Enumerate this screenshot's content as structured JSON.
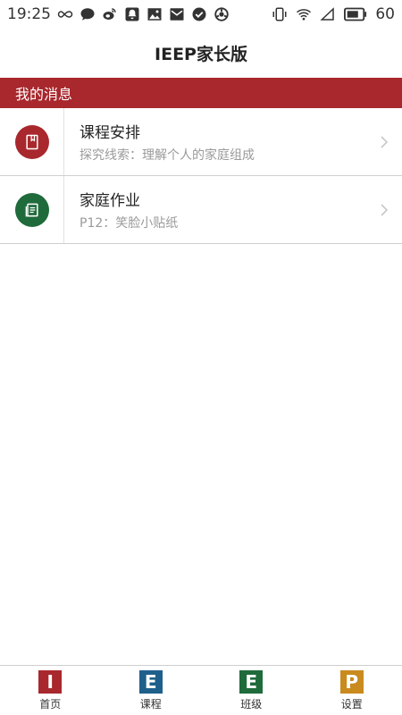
{
  "status_bar": {
    "time": "19:25",
    "battery": "60",
    "icons_left": [
      "infinity-icon",
      "chat-icon",
      "weibo-icon",
      "bell-icon",
      "image-icon",
      "mail-icon",
      "check-circle-icon",
      "sync-icon"
    ],
    "icons_right": [
      "vibrate-icon",
      "wifi-icon",
      "signal-icon",
      "battery-icon"
    ]
  },
  "header": {
    "title": "IEEP家长版"
  },
  "section": {
    "title": "我的消息",
    "color": "#a8282d"
  },
  "messages": [
    {
      "title": "课程安排",
      "subtitle": "探究线索：理解个人的家庭组成",
      "icon": "book-icon",
      "color": "#a8282d"
    },
    {
      "title": "家庭作业",
      "subtitle": "P12：笑脸小贴纸",
      "icon": "homework-icon",
      "color": "#1f6b3b"
    }
  ],
  "bottom_nav": [
    {
      "letter": "I",
      "label": "首页",
      "color": "#a8282d"
    },
    {
      "letter": "E",
      "label": "课程",
      "color": "#1f5f8b"
    },
    {
      "letter": "E",
      "label": "班级",
      "color": "#1f6b3b"
    },
    {
      "letter": "P",
      "label": "设置",
      "color": "#c98a1e"
    }
  ]
}
